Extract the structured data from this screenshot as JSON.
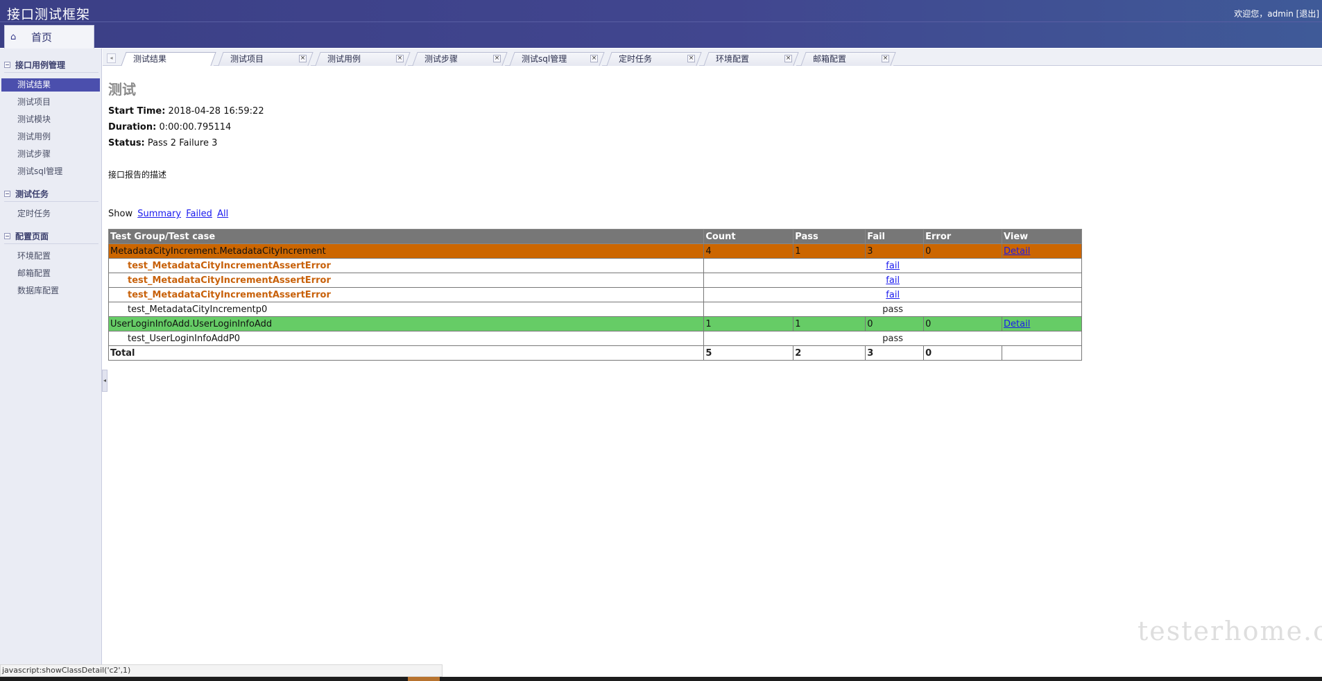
{
  "header": {
    "app_title": "接口测试框架",
    "welcome_text": "欢迎您，admin [退出]"
  },
  "home_tab": {
    "icon": "home-icon",
    "label": "首页"
  },
  "sidebar": {
    "sections": [
      {
        "title": "接口用例管理",
        "items": [
          "测试结果",
          "测试项目",
          "测试模块",
          "测试用例",
          "测试步骤",
          "测试sql管理"
        ]
      },
      {
        "title": "测试任务",
        "items": [
          "定时任务"
        ]
      },
      {
        "title": "配置页面",
        "items": [
          "环境配置",
          "邮箱配置",
          "数据库配置"
        ]
      }
    ],
    "active_item": "测试结果"
  },
  "tabs": [
    {
      "label": "测试结果",
      "active": true
    },
    {
      "label": "测试项目"
    },
    {
      "label": "测试用例"
    },
    {
      "label": "测试步骤"
    },
    {
      "label": "测试sql管理"
    },
    {
      "label": "定时任务"
    },
    {
      "label": "环境配置"
    },
    {
      "label": "邮箱配置"
    }
  ],
  "report": {
    "title": "测试",
    "start_time_label": "Start Time:",
    "start_time": "2018-04-28 16:59:22",
    "duration_label": "Duration:",
    "duration": "0:00:00.795114",
    "status_label": "Status:",
    "status": "Pass 2 Failure 3",
    "description": "接口报告的描述",
    "show_label": "Show",
    "show_links": [
      "Summary",
      "Failed",
      "All"
    ],
    "columns": [
      "Test Group/Test case",
      "Count",
      "Pass",
      "Fail",
      "Error",
      "View"
    ],
    "groups": [
      {
        "name": "MetadataCityIncrement.MetadataCityIncrement",
        "count": "4",
        "pass": "1",
        "fail": "3",
        "error": "0",
        "view": "Detail",
        "status": "fail",
        "cases": [
          {
            "name": "test_MetadataCityIncrementAssertError",
            "result": "fail",
            "status": "fail"
          },
          {
            "name": "test_MetadataCityIncrementAssertError",
            "result": "fail",
            "status": "fail"
          },
          {
            "name": "test_MetadataCityIncrementAssertError",
            "result": "fail",
            "status": "fail"
          },
          {
            "name": "test_MetadataCityIncrementp0",
            "result": "pass",
            "status": "pass"
          }
        ]
      },
      {
        "name": "UserLoginInfoAdd.UserLoginInfoAdd",
        "count": "1",
        "pass": "1",
        "fail": "0",
        "error": "0",
        "view": "Detail",
        "status": "pass",
        "cases": [
          {
            "name": "test_UserLoginInfoAddP0",
            "result": "pass",
            "status": "pass"
          }
        ]
      }
    ],
    "total": {
      "label": "Total",
      "count": "5",
      "pass": "2",
      "fail": "3",
      "error": "0"
    }
  },
  "statusbar_text": "javascript:showClassDetail('c2',1)",
  "watermark": "testerhome.com",
  "colors": {
    "header": "#3b3f86",
    "active_nav": "#4b4fad",
    "group_fail": "#cc6600",
    "group_pass": "#66cc66",
    "table_header": "#777777",
    "case_fail_text": "#c8610a"
  }
}
